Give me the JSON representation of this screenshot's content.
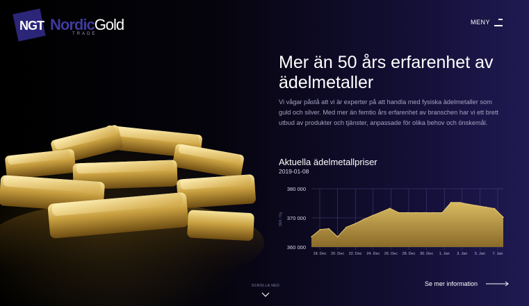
{
  "logo": {
    "initials": "NGT",
    "name_part1": "Nordic",
    "name_part2": "Gold",
    "subtitle": "TRADE"
  },
  "nav": {
    "menu_label": "MENY",
    "menu_icon": "hamburger-icon"
  },
  "hero": {
    "title": "Mer än 50 års erfarenhet av ädelmetaller",
    "text": "Vi vågar påstå att vi är experter på att handla med fysiska ädelmetaller som guld och silver. Med mer än femtio års erfarenhet av branschen har vi ett brett utbud av produkter och tjänster, anpassade för olika behov och önskemål."
  },
  "prices": {
    "title": "Aktuella ädelmetallpriser",
    "date": "2019-01-08"
  },
  "chart_data": {
    "type": "area",
    "ylabel": "SEK / Kg",
    "ylim": [
      360000,
      380000
    ],
    "yticks": [
      "360 000",
      "370 000",
      "380 000"
    ],
    "ytick_values": [
      360000,
      370000,
      380000
    ],
    "xticks": [
      "18. Dec",
      "20. Dec",
      "22. Dec",
      "24. Dec",
      "26. Dec",
      "28. Dec",
      "30. Dec",
      "1. Jan",
      "3. Jan",
      "5. Jan",
      "7. Jan"
    ],
    "x": [
      0,
      1,
      2,
      3,
      4,
      5,
      6,
      7,
      8,
      9,
      10,
      11,
      12,
      13,
      14,
      15,
      16,
      17,
      18,
      19,
      20,
      21,
      22
    ],
    "values": [
      363500,
      366000,
      366300,
      363500,
      366800,
      368000,
      369500,
      370800,
      372000,
      373300,
      371800,
      371800,
      371800,
      371800,
      371800,
      371800,
      375300,
      375300,
      374700,
      374200,
      373700,
      373200,
      370200
    ],
    "fill_top": "#d8bb62",
    "fill_bottom": "#8a6a28",
    "line_color": "#e6c872",
    "grid": true
  },
  "more_link": {
    "label": "Se mer information",
    "icon": "long-arrow-right-icon"
  },
  "scroll": {
    "label": "SCROLLA NED",
    "icon": "chevron-down-icon"
  },
  "colors": {
    "brand": "#3f3a9c",
    "background_dark": "#000000",
    "background_navy": "#1f1a52",
    "gold": "#d8bb62"
  }
}
